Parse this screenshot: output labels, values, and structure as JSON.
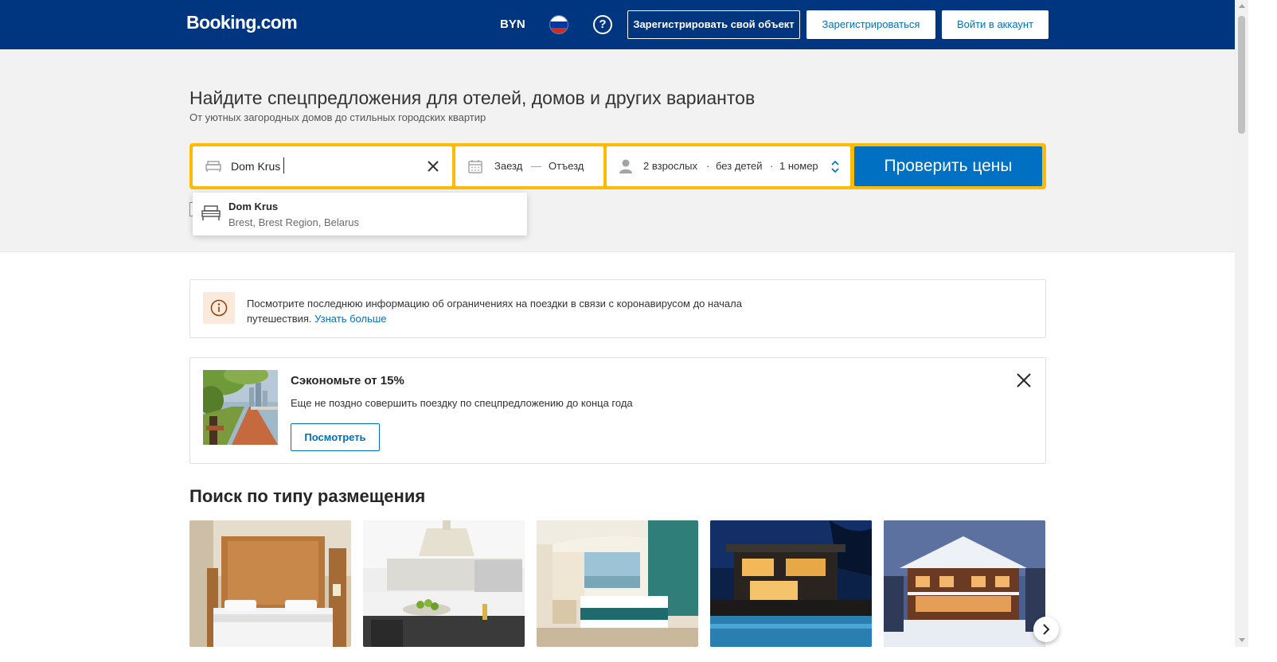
{
  "header": {
    "logo": "Booking.com",
    "currency": "BYN",
    "language_flag": "russia-flag",
    "help_icon": "?",
    "list_property_label": "Зарегистрировать свой объект",
    "register_label": "Зарегистрироваться",
    "signin_label": "Войти в аккаунт",
    "background": "#003580"
  },
  "hero": {
    "title": "Найдите спецпредложения для отелей, домов и других вариантов",
    "subtitle": "От уютных загородных домов до стильных городских квартир"
  },
  "search": {
    "destination_value": "Dom Krus",
    "destination_icon": "bed-icon",
    "clear_icon": "close-icon",
    "checkin_label": "Заезд",
    "date_separator": "—",
    "checkout_label": "Отъезд",
    "adults": "2 взрослых",
    "children": "без детей",
    "rooms": "1 номер",
    "dot": "·",
    "submit_label": "Проверить цены",
    "accent": "#febb02",
    "button_color": "#0071c2"
  },
  "autocomplete": {
    "items": [
      {
        "title": "Dom Krus",
        "subtitle": "Brest, Brest Region, Belarus",
        "icon": "bed-icon"
      }
    ]
  },
  "info_banner": {
    "icon": "info-icon",
    "text": "Посмотрите последнюю информацию об ограничениях на поездки в связи с коронавирусом до начала путешествия.",
    "link": "Узнать больше"
  },
  "promo": {
    "title": "Сэкономьте от 15%",
    "text": "Еще не поздно совершить поездку по спецпредложению до конца года",
    "button": "Посмотреть",
    "close_icon": "close-icon"
  },
  "property_types": {
    "title": "Поиск по типу размещения",
    "tiles": [
      "hotel-image",
      "apartment-image",
      "resort-image",
      "villa-image",
      "chalet-image"
    ],
    "next_icon": "chevron-right-icon"
  }
}
